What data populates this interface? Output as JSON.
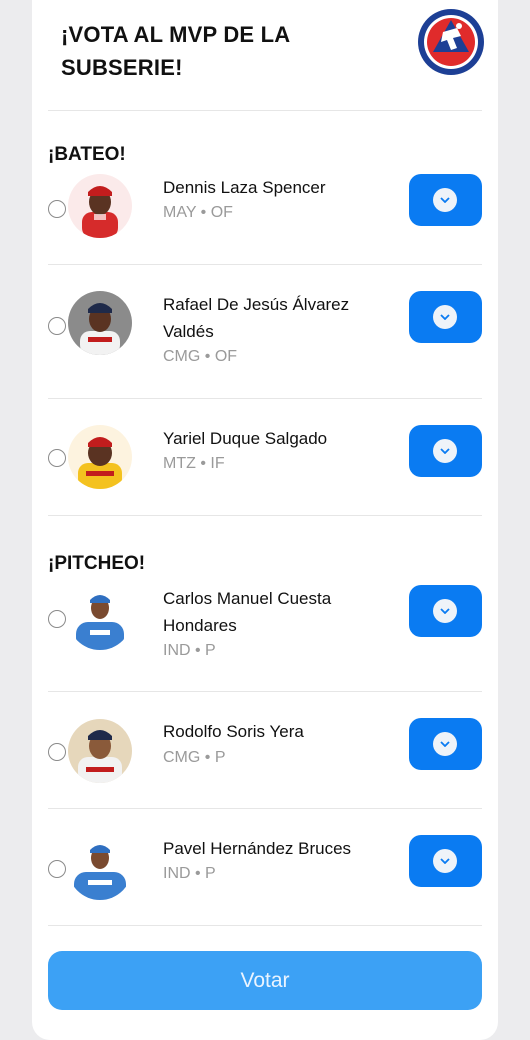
{
  "header": {
    "title_line1": "¡VOTA AL MVP DE LA",
    "title_line2": "SUBSERIE!",
    "logo_text": "SERIE NACIONAL DE BÉISBOL",
    "logo_sub": "CUBA"
  },
  "sections": [
    {
      "title": "¡BATEO!",
      "players": [
        {
          "name_line1": "Dennis Laza Spencer",
          "name_line2": "",
          "meta": "MAY • OF",
          "jersey_color": "#d62b2b",
          "cap_color": "#c21d1d"
        },
        {
          "name_line1": "Rafael De Jesús Álvarez",
          "name_line2": "Valdés",
          "meta": "CMG • OF",
          "jersey_color": "#f2f2f2",
          "cap_color": "#1f2a4a"
        },
        {
          "name_line1": "Yariel Duque Salgado",
          "name_line2": "",
          "meta": "MTZ • IF",
          "jersey_color": "#f4c21f",
          "cap_color": "#c21d1d"
        }
      ]
    },
    {
      "title": "¡PITCHEO!",
      "players": [
        {
          "name_line1": "Carlos Manuel Cuesta",
          "name_line2": "Hondares",
          "meta": "IND • P",
          "jersey_color": "#3a7fd0",
          "cap_color": "#2f6fc0"
        },
        {
          "name_line1": "Rodolfo Soris Yera",
          "name_line2": "",
          "meta": "CMG • P",
          "jersey_color": "#f2f2f2",
          "cap_color": "#1f2a4a"
        },
        {
          "name_line1": "Pavel Hernández Bruces",
          "name_line2": "",
          "meta": "IND • P",
          "jersey_color": "#3a7fd0",
          "cap_color": "#2f6fc0"
        }
      ]
    }
  ],
  "submit_label": "Votar",
  "colors": {
    "primary_button": "#0a7bf2",
    "submit_button": "#3ca1f5",
    "meta_text": "#9a9a9a"
  },
  "icons": {
    "vote_button_icon": "chevron-down-icon",
    "radio": "radio-button"
  }
}
